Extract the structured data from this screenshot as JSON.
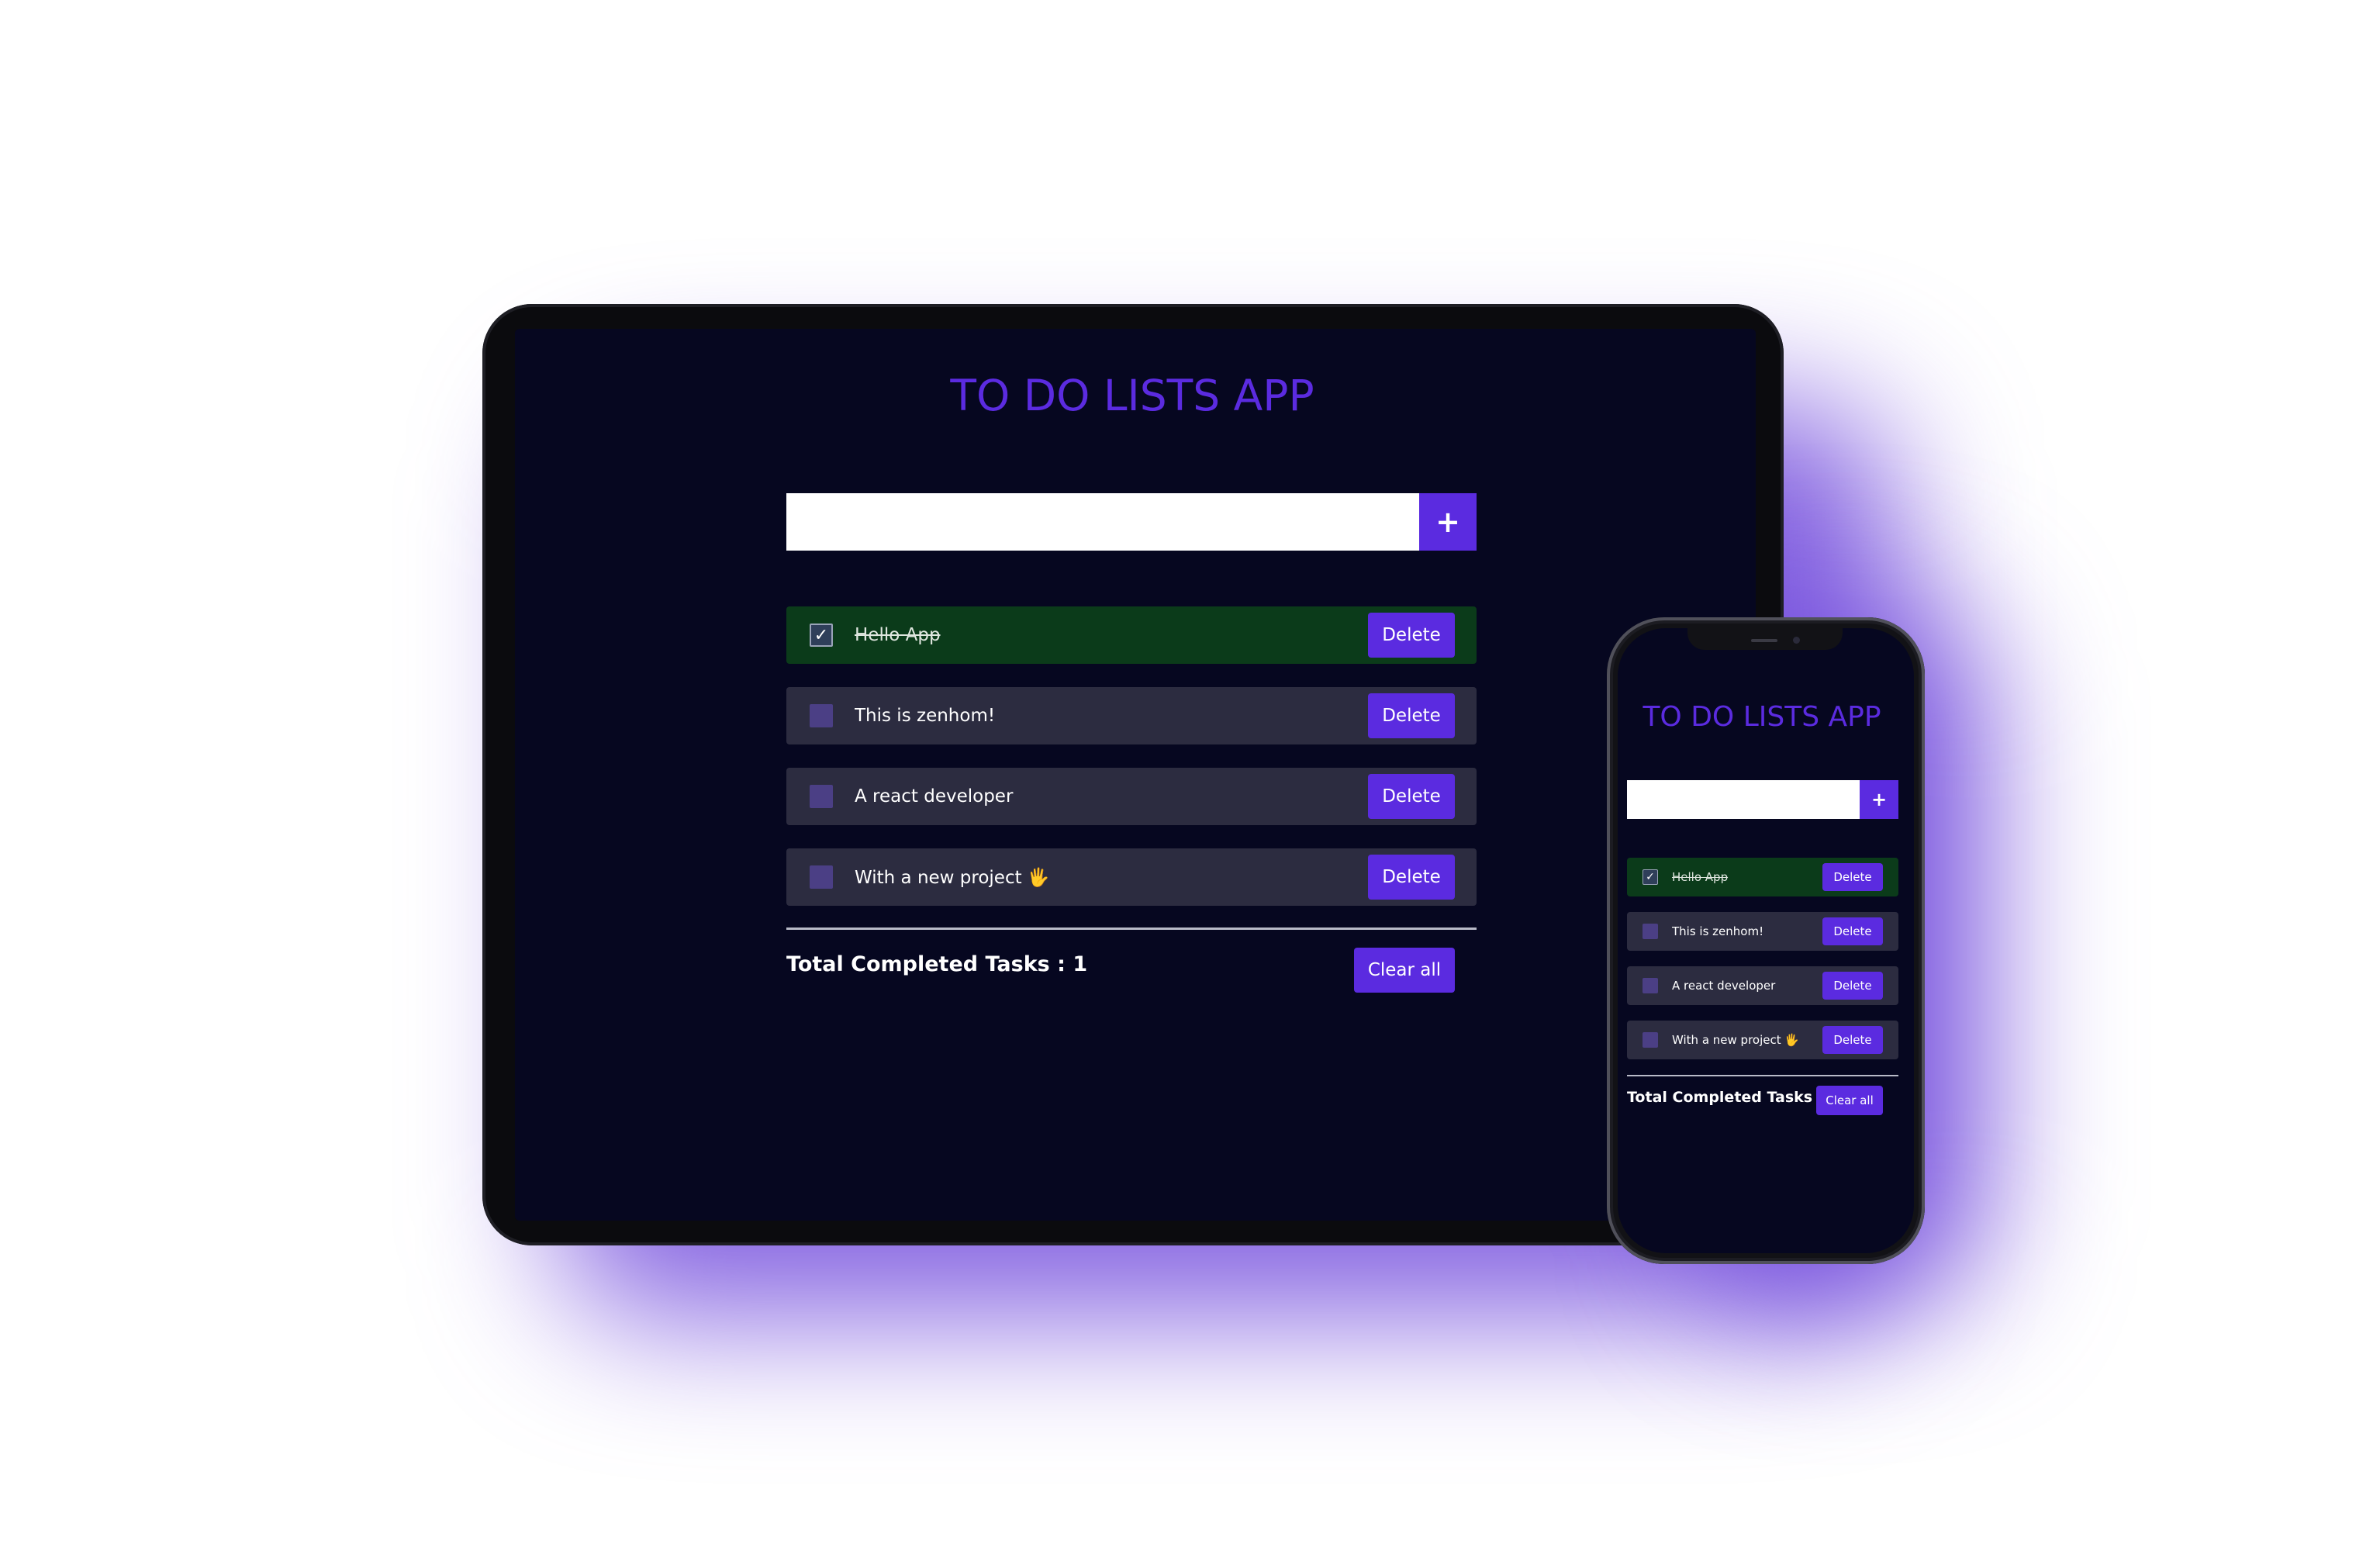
{
  "colors": {
    "accent": "#5b2be0",
    "screen_bg": "#060720",
    "task_bg": "#2c2c40",
    "task_done_bg": "#0b3b1a",
    "checkbox": "#4b3f85",
    "glow": "#6e46dc"
  },
  "app": {
    "title": "TO DO LISTS APP",
    "input": {
      "value": "",
      "placeholder": ""
    },
    "add_button_label": "+",
    "tasks": [
      {
        "text": "Hello App",
        "completed": true,
        "check_mark": "✓",
        "delete_label": "Delete"
      },
      {
        "text": "This is zenhom!",
        "completed": false,
        "check_mark": "",
        "delete_label": "Delete"
      },
      {
        "text": "A react developer",
        "completed": false,
        "check_mark": "",
        "delete_label": "Delete"
      },
      {
        "text": "With a new project 🖐",
        "completed": false,
        "check_mark": "",
        "delete_label": "Delete"
      }
    ],
    "total_completed_text": "Total Completed Tasks : 1",
    "clear_all_label": "Clear all"
  }
}
